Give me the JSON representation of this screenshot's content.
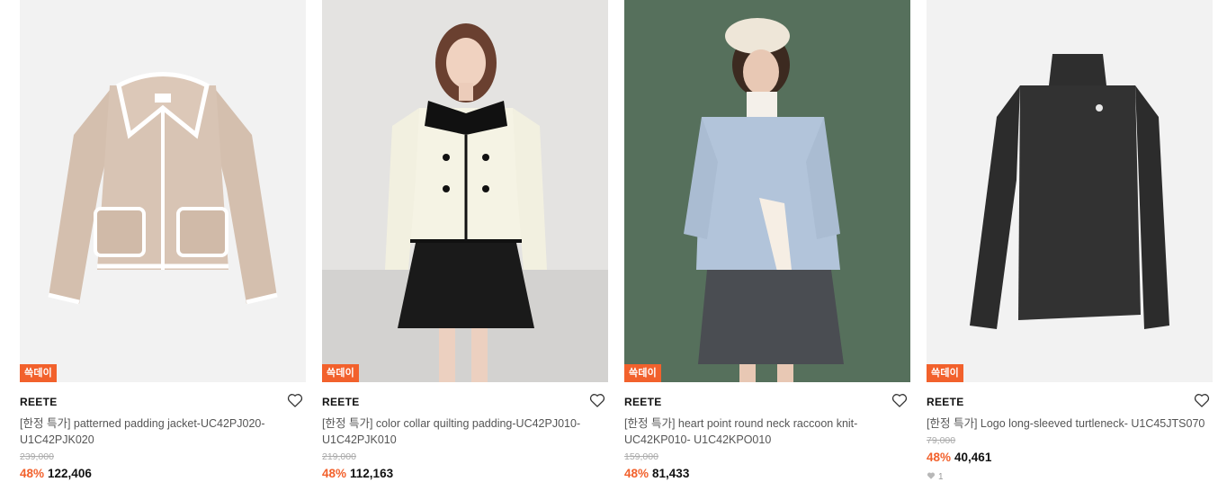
{
  "products": [
    {
      "badge": "쓱데이",
      "brand": "REETE",
      "title": "[한정 특가] patterned padding jacket-UC42PJ020-U1C42PJK020",
      "original_price": "239,000",
      "discount": "48%",
      "price": "122,406",
      "image": "beige-corduroy-jacket"
    },
    {
      "badge": "쓱데이",
      "brand": "REETE",
      "title": "[한정 특가] color collar quilting padding-UC42PJ010-U1C42PJK010",
      "original_price": "219,000",
      "discount": "48%",
      "price": "112,163",
      "image": "model-cream-quilted-jacket"
    },
    {
      "badge": "쓱데이",
      "brand": "REETE",
      "title": "[한정 특가] heart point round neck raccoon knit-UC42KP010- U1C42KPO010",
      "original_price": "159,000",
      "discount": "48%",
      "price": "81,433",
      "image": "model-blue-knit-beret"
    },
    {
      "badge": "쓱데이",
      "brand": "REETE",
      "title": "[한정 특가] Logo long-sleeved turtleneck- U1C45JTS070",
      "original_price": "79,000",
      "discount": "48%",
      "price": "40,461",
      "likes": "1",
      "image": "charcoal-turtleneck"
    }
  ],
  "icons": {
    "wishlist": "heart-outline-icon",
    "likes": "heart-filled-icon"
  },
  "colors": {
    "accent": "#f2612c",
    "text": "#222222",
    "muted": "#aaaaaa"
  }
}
